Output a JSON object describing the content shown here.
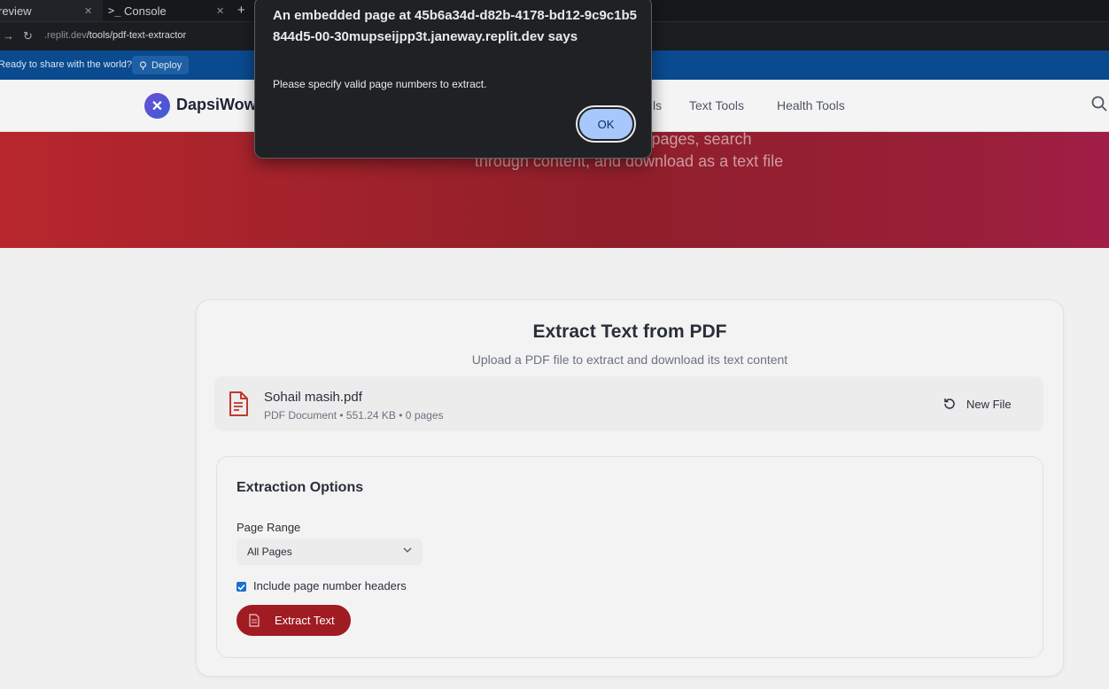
{
  "browser": {
    "tabs": [
      {
        "label": "review"
      },
      {
        "label": "Console"
      }
    ],
    "url": {
      "domain": ".replit.dev",
      "path": "/tools/pdf-text-extractor"
    },
    "deploy": {
      "message": "Ready to share with the world?",
      "button": "Deploy"
    }
  },
  "site": {
    "logo": "DapsiWow",
    "nav": [
      "ls",
      "Text Tools",
      "Health Tools"
    ]
  },
  "hero": {
    "description_line1": "ents. Select specific pages, search",
    "description_line2": "through content, and download as a text file"
  },
  "main": {
    "title": "Extract Text from PDF",
    "subtitle": "Upload a PDF file to extract and download its text content",
    "file": {
      "name": "Sohail masih.pdf",
      "meta": "PDF Document • 551.24 KB • 0 pages",
      "new_file_label": "New File"
    },
    "options": {
      "heading": "Extraction Options",
      "page_range_label": "Page Range",
      "page_range_value": "All Pages",
      "include_headers_label": "Include page number headers",
      "include_headers_checked": true,
      "extract_button": "Extract Text"
    }
  },
  "dialog": {
    "title": "An embedded page at 45b6a34d-d82b-4178-bd12-9c9c1b5844d5-00-30mupseijpp3t.janeway.replit.dev says",
    "message": "Please specify valid page numbers to extract.",
    "ok_label": "OK"
  },
  "colors": {
    "accent": "#a01b22",
    "hero_start": "#b8262d",
    "hero_end": "#a21d48",
    "dialog_button": "#a8c7fa"
  }
}
